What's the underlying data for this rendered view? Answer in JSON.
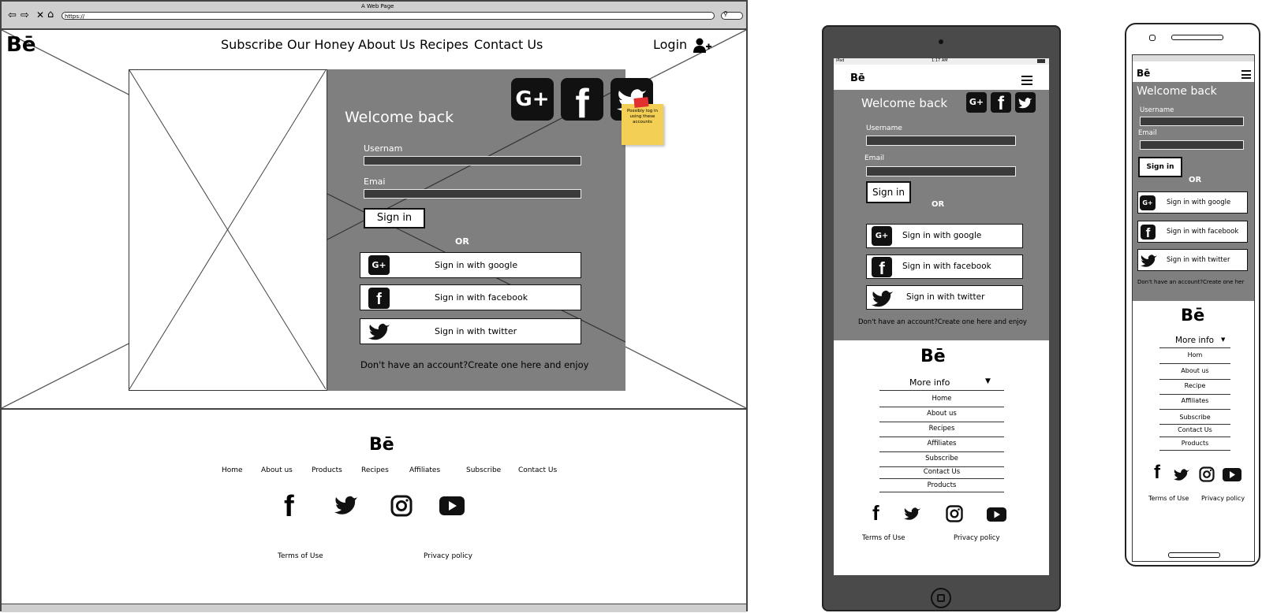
{
  "browser": {
    "title": "A Web Page",
    "address": "https://"
  },
  "desktop": {
    "logo": "Bē",
    "nav": [
      "Subscribe",
      "Our Honey",
      "About Us",
      "Recipes",
      "Contact Us"
    ],
    "login": "Login",
    "welcome": "Welcome back",
    "username_label": "Usernam",
    "email_label": "Emai",
    "signin": "Sign in",
    "or": "OR",
    "google": "Sign in with google",
    "facebook": "Sign in with facebook",
    "twitter": "Sign in with twitter",
    "signup_text": "Don't have an account?Create one here and enjoy",
    "sticky_note": "Possibly log in using these accounts",
    "footer": {
      "logo": "Bē",
      "links": [
        "Home",
        "About us",
        "Products",
        "Recipes",
        "Affiliates",
        "Subscribe",
        "Contact Us"
      ],
      "terms": "Terms of Use",
      "privacy": "Privacy policy"
    }
  },
  "tablet": {
    "status_left": "iPad",
    "status_time": "1:17 AM",
    "logo": "Bē",
    "welcome": "Welcome back",
    "username_label": "Username",
    "email_label": "Email",
    "signin": "Sign in",
    "or": "OR",
    "google": "Sign in with google",
    "facebook": "Sign in with facebook",
    "twitter": "Sign in with twitter",
    "signup_text": "Don't have an account?Create one here and enjoy",
    "footer": {
      "logo": "Bē",
      "more_info": "More info",
      "links": [
        "Home",
        "About us",
        "Recipes",
        "Affiliates",
        "Subscribe",
        "Contact Us",
        "Products"
      ],
      "terms": "Terms of Use",
      "privacy": "Privacy policy"
    }
  },
  "phone": {
    "logo": "Bē",
    "welcome": "Welcome back",
    "username_label": "Username",
    "email_label": "Email",
    "signin": "Sign in",
    "or": "OR",
    "google": "Sign in with google",
    "facebook": "Sign in with facebook",
    "twitter": "Sign in with twitter",
    "signup_text": "Don't have an account?Create one her",
    "footer": {
      "logo": "Bē",
      "more_info": "More info",
      "links": [
        "Hom",
        "About us",
        "Recipe",
        "Affiliates",
        "Subscribe",
        "Contact Us",
        "Products"
      ],
      "terms": "Terms of Use",
      "privacy": "Privacy policy"
    }
  },
  "colors": {
    "panel": "#7f7f7f",
    "device": "#4a4a4a",
    "sticky": "#f4cf55"
  }
}
